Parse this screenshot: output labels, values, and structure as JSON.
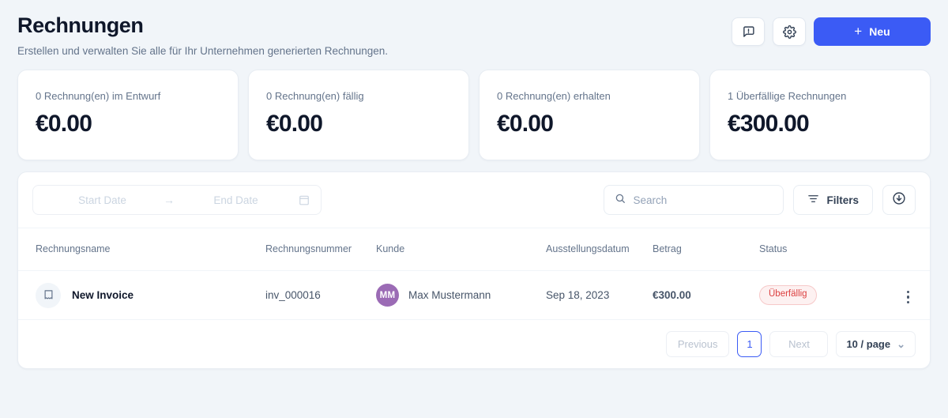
{
  "header": {
    "title": "Rechnungen",
    "subtitle": "Erstellen und verwalten Sie alle für Ihr Unternehmen generierten Rechnungen.",
    "feedback_icon": "feedback-chat-icon",
    "settings_icon": "gear-icon",
    "new_button": {
      "label": "Neu",
      "plus": "+",
      "color": "#3b5bf5"
    }
  },
  "stats": [
    {
      "label": "0 Rechnung(en) im Entwurf",
      "value": "€0.00"
    },
    {
      "label": "0 Rechnung(en) fällig",
      "value": "€0.00"
    },
    {
      "label": "0 Rechnung(en) erhalten",
      "value": "€0.00"
    },
    {
      "label": "1 Überfällige Rechnungen",
      "value": "€300.00"
    }
  ],
  "toolbar": {
    "date_range": {
      "start_placeholder": "Start Date",
      "end_placeholder": "End Date",
      "separator": "→",
      "calendar_icon": "calendar-icon"
    },
    "search": {
      "placeholder": "Search",
      "value": "",
      "icon": "search-icon"
    },
    "filters_label": "Filters",
    "filters_icon": "filter-icon",
    "export_icon": "download-circle-icon"
  },
  "table": {
    "columns": [
      "Rechnungsname",
      "Rechnungsnummer",
      "Kunde",
      "Ausstellungsdatum",
      "Betrag",
      "Status"
    ],
    "rows": [
      {
        "name": "New Invoice",
        "doc_icon": "receipt-icon",
        "number": "inv_000016",
        "customer": "Max Mustermann",
        "initials": "MM",
        "avatar_color": "#9b6bb5",
        "date": "Sep 18, 2023",
        "amount": "€300.00",
        "status": "Überfällig",
        "status_color": "#dc4040",
        "menu_icon": "kebab-menu-icon"
      }
    ]
  },
  "pagination": {
    "previous": "Previous",
    "next": "Next",
    "current_page": "1",
    "page_size": "10 / page",
    "chevron": "⌄"
  }
}
